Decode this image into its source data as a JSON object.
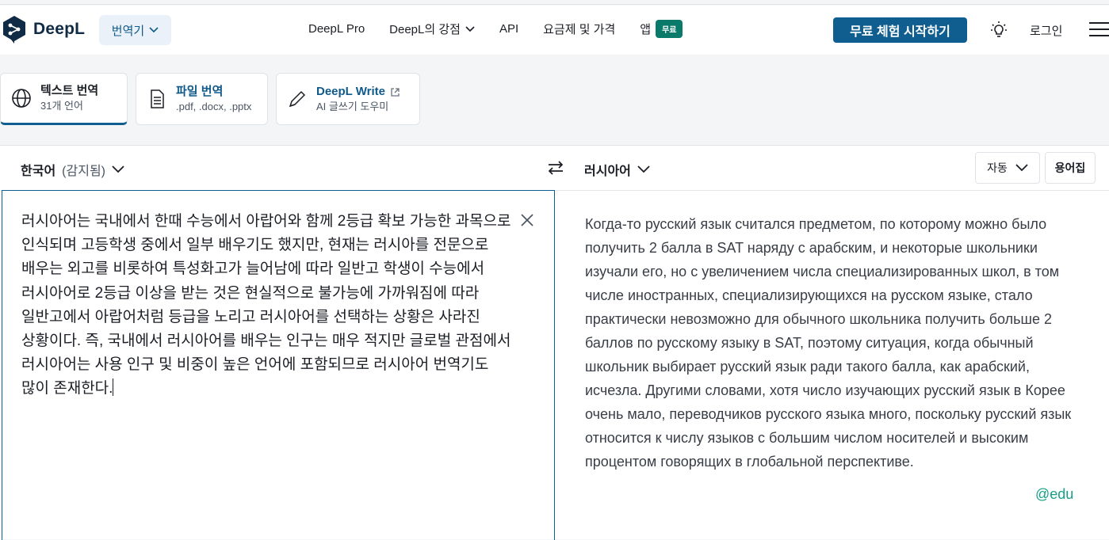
{
  "header": {
    "logo_text": "DeepL",
    "translator_label": "번역기",
    "nav": [
      {
        "label": "DeepL Pro"
      },
      {
        "label": "DeepL의 강점"
      },
      {
        "label": "API"
      },
      {
        "label": "요금제 및 가격"
      },
      {
        "label": "앱",
        "badge": "무료"
      }
    ],
    "cta_label": "무료 체험 시작하기",
    "login_label": "로그인"
  },
  "tabs": [
    {
      "title": "텍스트 번역",
      "subtitle": "31개 언어"
    },
    {
      "title": "파일 번역",
      "subtitle": ".pdf, .docx, .pptx"
    },
    {
      "title": "DeepL Write",
      "subtitle": "AI 글쓰기 도우미"
    }
  ],
  "translator": {
    "source_lang": "한국어",
    "source_detected": "(감지됨)",
    "target_lang": "러시아어",
    "formality_label": "자동",
    "glossary_label": "용어집",
    "source_text": "러시아어는 국내에서 한때 수능에서 아랍어와 함께 2등급 확보 가능한 과목으로 인식되며 고등학생 중에서 일부 배우기도 했지만, 현재는 러시아를 전문으로 배우는 외고를 비롯하여 특성화고가 늘어남에 따라 일반고 학생이 수능에서 러시아어로 2등급 이상을 받는 것은 현실적으로 불가능에 가까워짐에 따라 일반고에서 아랍어처럼 등급을 노리고 러시아어를 선택하는 상황은 사라진 상황이다. 즉, 국내에서 러시아어를 배우는 인구는 매우 적지만 글로벌 관점에서 러시아어는 사용 인구 및 비중이 높은 언어에 포함되므로 러시아어 번역기도 많이 존재한다.",
    "target_text": "Когда-то русский язык считался предметом, по которому можно было получить 2 балла в SAT наряду с арабским, и некоторые школьники изучали его, но с увеличением числа специализированных школ, в том числе иностранных, специализирующихся на русском языке, стало практически невозможно для обычного школьника получить больше 2 баллов по русскому языку в SAT, поэтому ситуация, когда обычный школьник выбирает русский язык ради такого балла, как арабский, исчезла. Другими словами, хотя число изучающих русский язык в Корее очень мало, переводчиков русского языка много, поскольку русский язык относится к числу языков с большим числом носителей и высоким процентом говорящих в глобальной перспективе.",
    "watermark": "@edu"
  },
  "colors": {
    "brand": "#0f2b46",
    "cta": "#0f5e8f",
    "badge": "#0a7b6b"
  }
}
